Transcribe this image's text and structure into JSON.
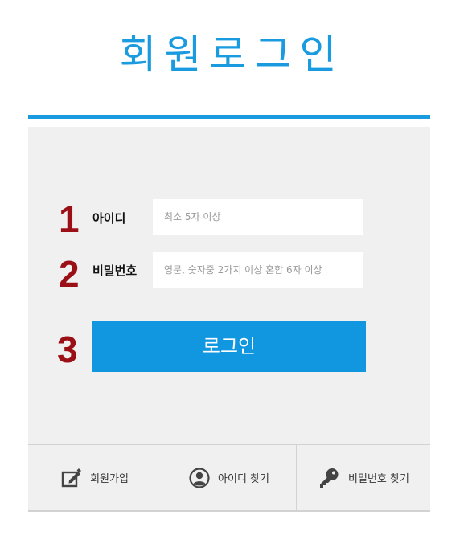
{
  "page": {
    "title": "회원로그인"
  },
  "form": {
    "steps": [
      "1",
      "2",
      "3"
    ],
    "id_label": "아이디",
    "id_placeholder": "최소 5자 이상",
    "id_value": "",
    "pw_label": "비밀번호",
    "pw_placeholder": "영문, 숫자중 2가지 이상 혼합 6자 이상",
    "pw_value": "",
    "login_label": "로그인"
  },
  "footer": {
    "items": [
      {
        "label": "회원가입",
        "icon": "edit-icon"
      },
      {
        "label": "아이디 찾기",
        "icon": "user-icon"
      },
      {
        "label": "비밀번호 찾기",
        "icon": "key-icon"
      }
    ]
  },
  "colors": {
    "accent": "#1a9be0",
    "button": "#1196e0",
    "step_number": "#9b1016",
    "panel": "#f0f0f0"
  }
}
